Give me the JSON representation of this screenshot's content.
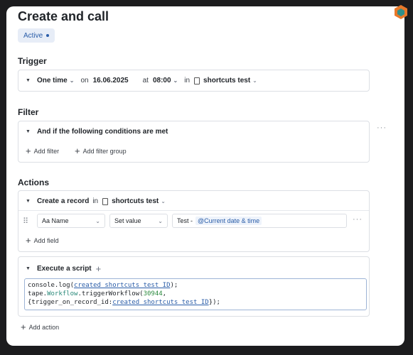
{
  "page": {
    "title": "Create and call",
    "status": "Active"
  },
  "trigger": {
    "heading": "Trigger",
    "frequency": "One time",
    "on_label": "on",
    "date": "16.06.2025",
    "at_label": "at",
    "time": "08:00",
    "in_label": "in",
    "table": "shortcuts test"
  },
  "filter": {
    "heading": "Filter",
    "condition": "And if the following conditions are met",
    "add_filter": "Add filter",
    "add_filter_group": "Add filter group",
    "more": "···"
  },
  "actions": {
    "heading": "Actions",
    "create": {
      "label": "Create a record",
      "in_label": "in",
      "table": "shortcuts test",
      "field": {
        "drag": "⠿",
        "name": "Aa Name",
        "op": "Set value",
        "value_prefix": "Test -",
        "value_tag": "@Current date & time",
        "more": "···"
      },
      "add_field": "Add field"
    },
    "script": {
      "label": "Execute a script",
      "add": "+",
      "lines": [
        {
          "a": "console.log(",
          "b": "created_shortcuts_test_ID",
          "c": ");"
        },
        {
          "a": "tape.",
          "b": "Workflow",
          "c": ".triggerWorkflow(",
          "d": "30944",
          "e": ","
        },
        {
          "a": "{trigger_on_record_id:",
          "b": "created_shortcuts_test_ID",
          "c": "});"
        }
      ]
    },
    "add_action": "Add action"
  },
  "colors": {
    "accent": "#2a5da8",
    "logo_orange": "#e8782a",
    "logo_teal": "#2f8f8a"
  }
}
